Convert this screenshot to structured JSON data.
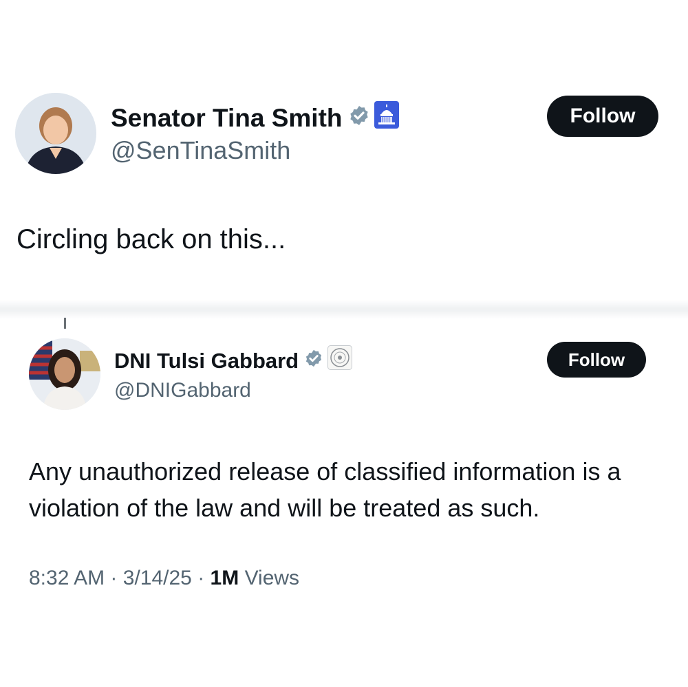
{
  "main_tweet": {
    "display_name": "Senator Tina Smith",
    "handle": "@SenTinaSmith",
    "follow_label": "Follow",
    "text": "Circling back on this..."
  },
  "quoted_tweet": {
    "display_name": "DNI Tulsi Gabbard",
    "handle": "@DNIGabbard",
    "follow_label": "Follow",
    "text": "Any unauthorized release of classified information is a violation of the law and will be treated as such.",
    "time": "8:32 AM",
    "date": "3/14/25",
    "views_count": "1M",
    "views_label": "Views",
    "separator": "·"
  },
  "icons": {
    "verified": "verified-badge-icon",
    "top_affiliation": "capitol-affiliation-icon",
    "quoted_affiliation": "dni-seal-affiliation-icon"
  },
  "colors": {
    "text": "#0f1419",
    "secondary": "#536471",
    "button_bg": "#0f1419",
    "verified": "#829aab",
    "affiliation_blue": "#3b5bdb"
  }
}
